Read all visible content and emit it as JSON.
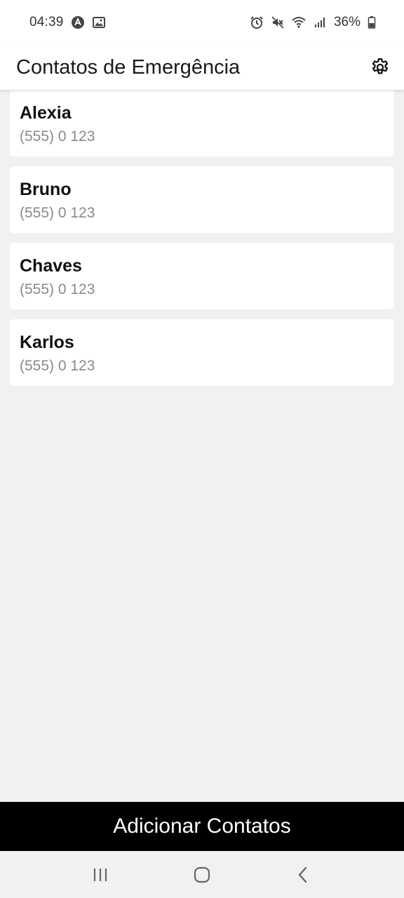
{
  "status_bar": {
    "time": "04:39",
    "battery_percent": "36%",
    "left_icons": [
      "app-notification-icon",
      "image-icon"
    ],
    "right_icons": [
      "alarm-icon",
      "mute-icon",
      "wifi-icon",
      "signal-icon",
      "battery-icon"
    ]
  },
  "app_bar": {
    "title": "Contatos de Emergência",
    "settings_icon": "gear-icon"
  },
  "contacts": [
    {
      "name": "Alexia",
      "phone": "(555) 0 123"
    },
    {
      "name": "Bruno",
      "phone": "(555) 0 123"
    },
    {
      "name": "Chaves",
      "phone": "(555) 0 123"
    },
    {
      "name": "Karlos",
      "phone": "(555) 0 123"
    }
  ],
  "add_button": {
    "label": "Adicionar Contatos"
  },
  "nav_bar": {
    "buttons": [
      "recent-apps-icon",
      "home-icon",
      "back-icon"
    ]
  },
  "colors": {
    "background": "#f1f1f1",
    "card": "#ffffff",
    "phone_text": "#8a8a8a",
    "add_button_bg": "#000000",
    "add_button_text": "#ffffff"
  }
}
